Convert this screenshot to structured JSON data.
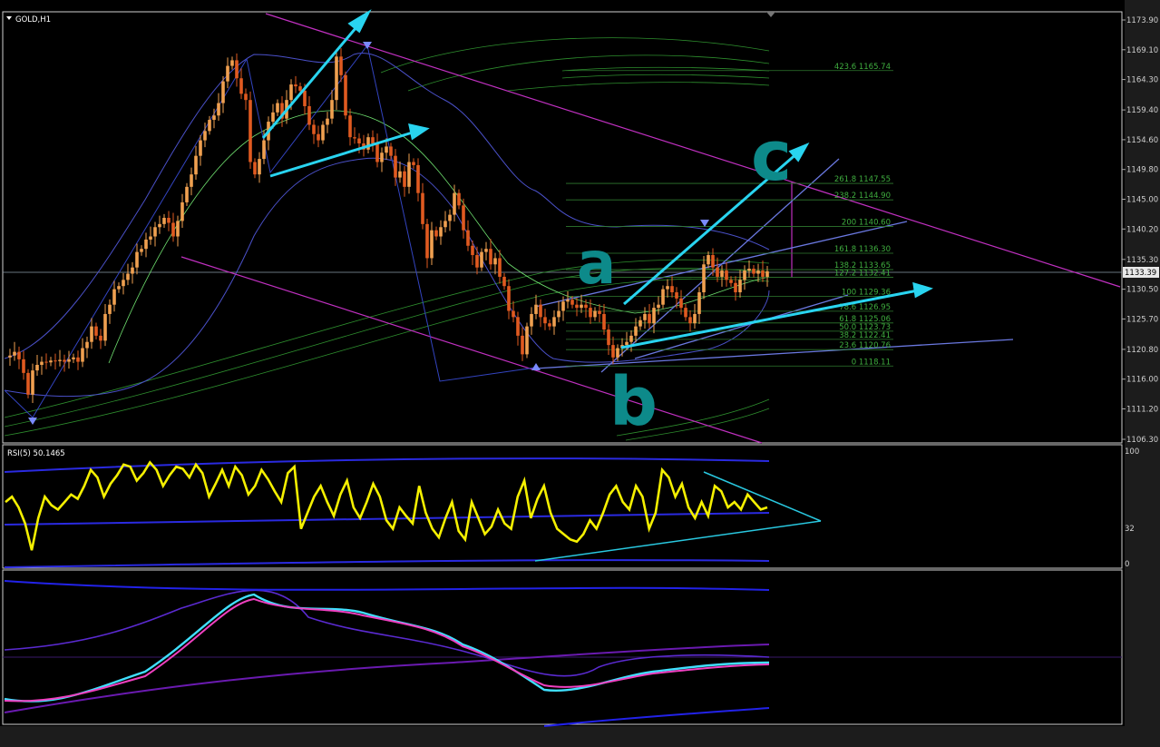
{
  "window": {
    "symbol_title": "GOLD,H1"
  },
  "rsi_pane": {
    "title": "RSI(5) 50.1465",
    "levels": [
      "100",
      "32",
      "0"
    ]
  },
  "annotations": {
    "wave_a": "a",
    "wave_b": "b",
    "wave_c": "c"
  },
  "colors": {
    "background": "#000000",
    "bull_candle": "#f0a050",
    "bear_candle": "#e05a20",
    "trend_arrow": "#29d4f0",
    "channel_magenta": "#c030c0",
    "bollinger": "#4a50c8",
    "ma_green": "#2e8f2e",
    "rsi_line": "#f5f000",
    "fib_text": "#3fae3f",
    "handwriting": "#0d8a8a"
  },
  "icons": {
    "chart_menu": "triangle-down-icon",
    "scroll_marker": "triangle-down-icon",
    "pivot_arrows": "arrow-icon"
  },
  "chart_data": {
    "type": "line",
    "title": "GOLD,H1",
    "price_axis": {
      "ticks": [
        1173.9,
        1169.1,
        1164.3,
        1159.4,
        1154.6,
        1149.8,
        1145.0,
        1140.2,
        1135.3,
        1130.5,
        1125.7,
        1120.8,
        1116.0,
        1111.2,
        1106.3
      ],
      "current": "1133.39",
      "ylim": [
        1106.3,
        1173.9
      ]
    },
    "fibonacci": [
      {
        "label": "423.6 1165.74",
        "price": 1165.74
      },
      {
        "label": "261.8 1147.55",
        "price": 1147.55
      },
      {
        "label": "238.2 1144.90",
        "price": 1144.9
      },
      {
        "label": "200 1140.60",
        "price": 1140.6
      },
      {
        "label": "161.8 1136.30",
        "price": 1136.3
      },
      {
        "label": "138.2 1133.65",
        "price": 1133.65
      },
      {
        "label": "127.2 1132.41",
        "price": 1132.41
      },
      {
        "label": "100 1129.36",
        "price": 1129.36
      },
      {
        "label": "78.6 1126.95",
        "price": 1126.95
      },
      {
        "label": "61.8 1125.06",
        "price": 1125.06
      },
      {
        "label": "50.0 1123.73",
        "price": 1123.73
      },
      {
        "label": "38.2 1122.41",
        "price": 1122.41
      },
      {
        "label": "23.6 1120.76",
        "price": 1120.76
      },
      {
        "label": "0 1118.11",
        "price": 1118.11
      }
    ],
    "price_path": [
      1119.5,
      1119.8,
      1120.4,
      1119.2,
      1117.0,
      1113.5,
      1117.4,
      1118.3,
      1118.8,
      1118.7,
      1119.0,
      1118.9,
      1119.1,
      1118.8,
      1119.2,
      1119.5,
      1118.8,
      1121.0,
      1122.0,
      1124.5,
      1123.0,
      1122.2,
      1126.5,
      1128.0,
      1130.5,
      1131.0,
      1132.0,
      1133.0,
      1134.0,
      1136.5,
      1137.0,
      1138.5,
      1139.0,
      1140.5,
      1141.0,
      1142.0,
      1141.2,
      1139.0,
      1141.5,
      1144.5,
      1147.0,
      1149.0,
      1152.0,
      1154.5,
      1156.0,
      1157.8,
      1158.5,
      1160.5,
      1164.0,
      1166.5,
      1167.4,
      1164.5,
      1162.0,
      1161.0,
      1151.0,
      1149.0,
      1151.5,
      1154.5,
      1157.5,
      1159.0,
      1160.5,
      1158.0,
      1161.0,
      1163.5,
      1163.2,
      1162.5,
      1160.0,
      1157.0,
      1155.5,
      1154.5,
      1157.0,
      1158.0,
      1161.0,
      1168.0,
      1165.0,
      1158.5,
      1155.0,
      1154.8,
      1154.0,
      1153.0,
      1155.0,
      1154.0,
      1151.0,
      1152.5,
      1153.5,
      1152.0,
      1148.5,
      1149.5,
      1147.0,
      1151.0,
      1150.5,
      1146.0,
      1141.0,
      1135.5,
      1140.0,
      1139.0,
      1140.5,
      1141.5,
      1142.5,
      1146.0,
      1144.0,
      1140.0,
      1137.5,
      1136.0,
      1134.0,
      1136.5,
      1137.0,
      1134.5,
      1135.5,
      1132.5,
      1131.0,
      1127.0,
      1126.0,
      1123.0,
      1120.0,
      1124.5,
      1126.5,
      1128.0,
      1126.0,
      1125.0,
      1124.5,
      1126.0,
      1127.0,
      1128.5,
      1128.8,
      1128.0,
      1127.5,
      1128.0,
      1127.5,
      1126.0,
      1127.0,
      1126.5,
      1124.0,
      1121.5,
      1119.5,
      1121.0,
      1121.5,
      1122.0,
      1123.0,
      1124.5,
      1125.5,
      1126.5,
      1125.0,
      1127.5,
      1128.0,
      1130.5,
      1131.0,
      1130.0,
      1129.0,
      1127.5,
      1126.0,
      1125.0,
      1126.5,
      1130.0,
      1134.5,
      1136.0,
      1134.0,
      1132.5,
      1133.5,
      1132.0,
      1131.5,
      1130.0,
      1132.0,
      1133.5,
      1133.8,
      1133.0,
      1133.5,
      1132.5,
      1133.39
    ],
    "rsi_path": [
      55,
      60,
      50,
      35,
      10,
      40,
      60,
      52,
      48,
      55,
      62,
      58,
      70,
      85,
      78,
      60,
      72,
      80,
      90,
      88,
      75,
      82,
      92,
      85,
      70,
      80,
      88,
      86,
      78,
      90,
      82,
      60,
      72,
      85,
      70,
      88,
      80,
      62,
      70,
      85,
      76,
      65,
      55,
      82,
      88,
      30,
      45,
      60,
      70,
      55,
      42,
      62,
      75,
      50,
      40,
      55,
      72,
      60,
      38,
      30,
      50,
      42,
      35,
      70,
      45,
      30,
      22,
      40,
      55,
      28,
      20,
      55,
      40,
      25,
      32,
      48,
      35,
      30,
      60,
      75,
      40,
      58,
      70,
      45,
      30,
      25,
      20,
      18,
      25,
      38,
      30,
      45,
      62,
      70,
      55,
      48,
      70,
      60,
      30,
      45,
      85,
      78,
      60,
      72,
      50,
      40,
      55,
      42,
      70,
      65,
      50,
      55,
      48,
      62,
      55,
      48,
      50
    ],
    "rsi_trend_levels": [
      100,
      32,
      0
    ]
  }
}
